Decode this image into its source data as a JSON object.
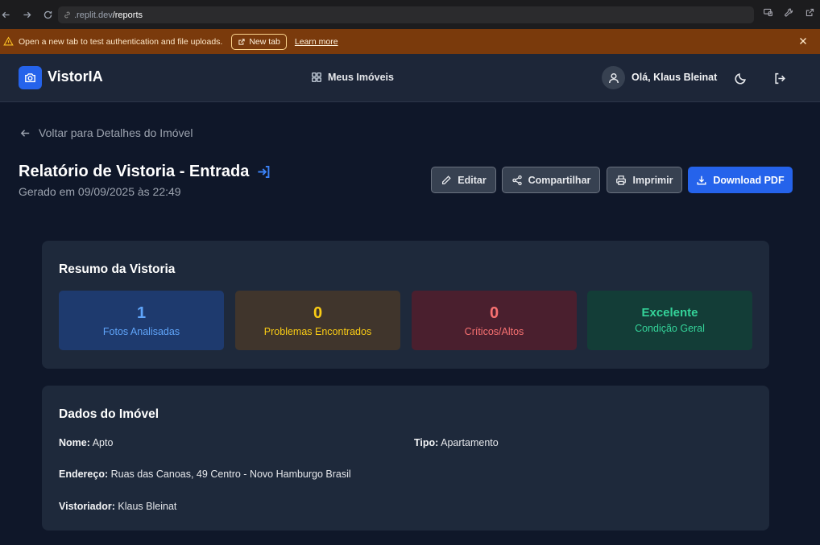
{
  "browser": {
    "url_host": ".replit.dev",
    "url_path": "/reports"
  },
  "banner": {
    "message": "Open a new tab to test authentication and file uploads.",
    "new_tab_label": "New tab",
    "learn_more_label": "Learn more"
  },
  "header": {
    "brand": "VistorIA",
    "nav_label": "Meus Imóveis",
    "greeting": "Olá, Klaus Bleinat"
  },
  "page": {
    "back_label": "Voltar para Detalhes do Imóvel",
    "title": "Relatório de Vistoria - Entrada",
    "subtitle": "Gerado em 09/09/2025 às 22:49"
  },
  "actions": {
    "edit": "Editar",
    "share": "Compartilhar",
    "print": "Imprimir",
    "download": "Download PDF"
  },
  "summary": {
    "title": "Resumo da Vistoria",
    "stats": [
      {
        "value": "1",
        "label": "Fotos Analisadas",
        "color": "#60a5fa"
      },
      {
        "value": "0",
        "label": "Problemas Encontrados",
        "color": "#facc15"
      },
      {
        "value": "0",
        "label": "Críticos/Altos",
        "color": "#f87171"
      },
      {
        "value": "Excelente",
        "label": "Condição Geral",
        "color": "#34d399"
      }
    ]
  },
  "property": {
    "title": "Dados do Imóvel",
    "name_label": "Nome:",
    "name_value": "Apto",
    "type_label": "Tipo:",
    "type_value": "Apartamento",
    "address_label": "Endereço:",
    "address_value": "Ruas das Canoas, 49 Centro - Novo Hamburgo Brasil",
    "inspector_label": "Vistoriador:",
    "inspector_value": "Klaus Bleinat"
  },
  "colors": {
    "accent": "#2563eb",
    "background": "#0f1729",
    "card": "#1e293b",
    "banner": "#7a3a0c"
  }
}
